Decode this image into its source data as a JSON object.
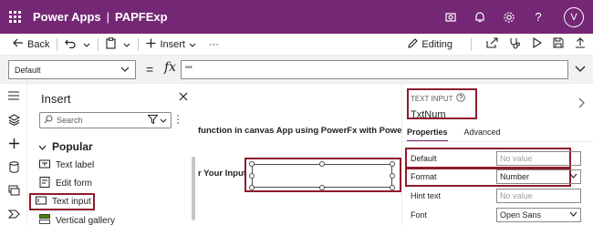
{
  "topbar": {
    "product": "Power Apps",
    "separator": "|",
    "app_name": "PAPFExp",
    "avatar_initial": "V"
  },
  "commandbar": {
    "back_label": "Back",
    "insert_label": "Insert",
    "more_label": "···",
    "editing_label": "Editing"
  },
  "formulabar": {
    "property": "Default",
    "equals": "=",
    "fx": "fx",
    "formula": "\"\""
  },
  "insert_panel": {
    "title": "Insert",
    "search_placeholder": "Search",
    "group": "Popular",
    "items": [
      "Text label",
      "Edit form",
      "Text input",
      "Vertical gallery"
    ]
  },
  "canvas": {
    "heading": "function in canvas App using PowerFx with Power a",
    "label": "r Your Input"
  },
  "properties": {
    "control_type": "TEXT INPUT",
    "control_name": "TxtNum",
    "tabs": [
      "Properties",
      "Advanced"
    ],
    "rows": [
      {
        "label": "Default",
        "value": "No value",
        "placeholder": true
      },
      {
        "label": "Format",
        "value": "Number",
        "placeholder": false
      },
      {
        "label": "Hint text",
        "value": "No value",
        "placeholder": true
      },
      {
        "label": "Font",
        "value": "Open Sans",
        "placeholder": false
      }
    ]
  },
  "colors": {
    "brand": "#742774",
    "highlight": "#8e1b2c"
  }
}
